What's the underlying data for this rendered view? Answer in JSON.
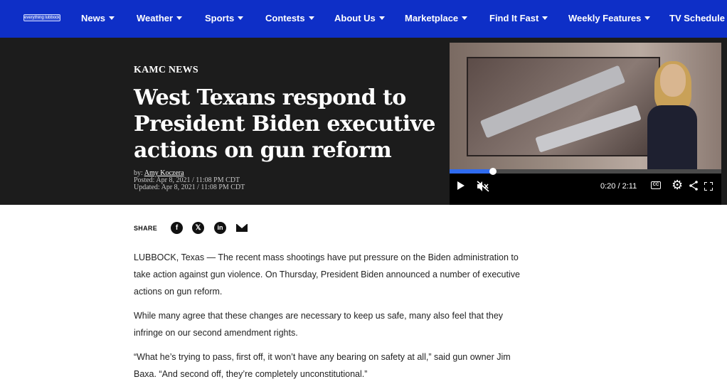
{
  "nav": {
    "logo_text": "everything lubbock",
    "items": [
      {
        "label": "News",
        "caret": true
      },
      {
        "label": "Weather",
        "caret": true
      },
      {
        "label": "Sports",
        "caret": true
      },
      {
        "label": "Contests",
        "caret": true
      },
      {
        "label": "About Us",
        "caret": true
      },
      {
        "label": "Marketplace",
        "caret": true
      },
      {
        "label": "Find It Fast",
        "caret": true
      },
      {
        "label": "Weekly Features",
        "caret": true
      },
      {
        "label": "TV Schedule",
        "caret": false
      }
    ]
  },
  "hero": {
    "station": "KAMC NEWS",
    "headline": "West Texans respond to President Biden executive actions on gun reform",
    "byline_prefix": "by: ",
    "author": "Amy Koczera",
    "posted": "Posted: Apr 8, 2021 / 11:08 PM CDT",
    "updated": "Updated: Apr 8, 2021 / 11:08 PM CDT"
  },
  "video": {
    "progress_fraction": 0.16,
    "time_current": "0:20",
    "time_separator": " / ",
    "time_total": "2:11",
    "cc_label": "CC",
    "icons": [
      "play-icon",
      "mute-icon",
      "cc-icon",
      "gear-icon",
      "share-icon",
      "fullscreen-icon"
    ]
  },
  "share": {
    "label": "SHARE",
    "buttons": [
      {
        "name": "facebook-icon",
        "glyph": "f"
      },
      {
        "name": "x-icon",
        "glyph": "𝕏"
      },
      {
        "name": "linkedin-icon",
        "glyph": "in"
      },
      {
        "name": "mail-icon",
        "glyph": ""
      }
    ]
  },
  "article": {
    "paragraphs": [
      "LUBBOCK, Texas — The recent mass shootings have put pressure on the Biden administration to take action against gun violence. On Thursday, President Biden announced a number of executive actions on gun reform.",
      "While many agree that these changes are necessary to keep us safe, many also feel that they infringe on our second amendment rights.",
      "“What he’s trying to pass, first off, it won’t have any bearing on safety at all,” said gun owner Jim Baxa. “And second off, they’re completely unconstitutional.”"
    ]
  },
  "colors": {
    "nav_bg": "#0e2fc7",
    "hero_bg": "#1c1c1c",
    "progress": "#2f6bf0"
  }
}
